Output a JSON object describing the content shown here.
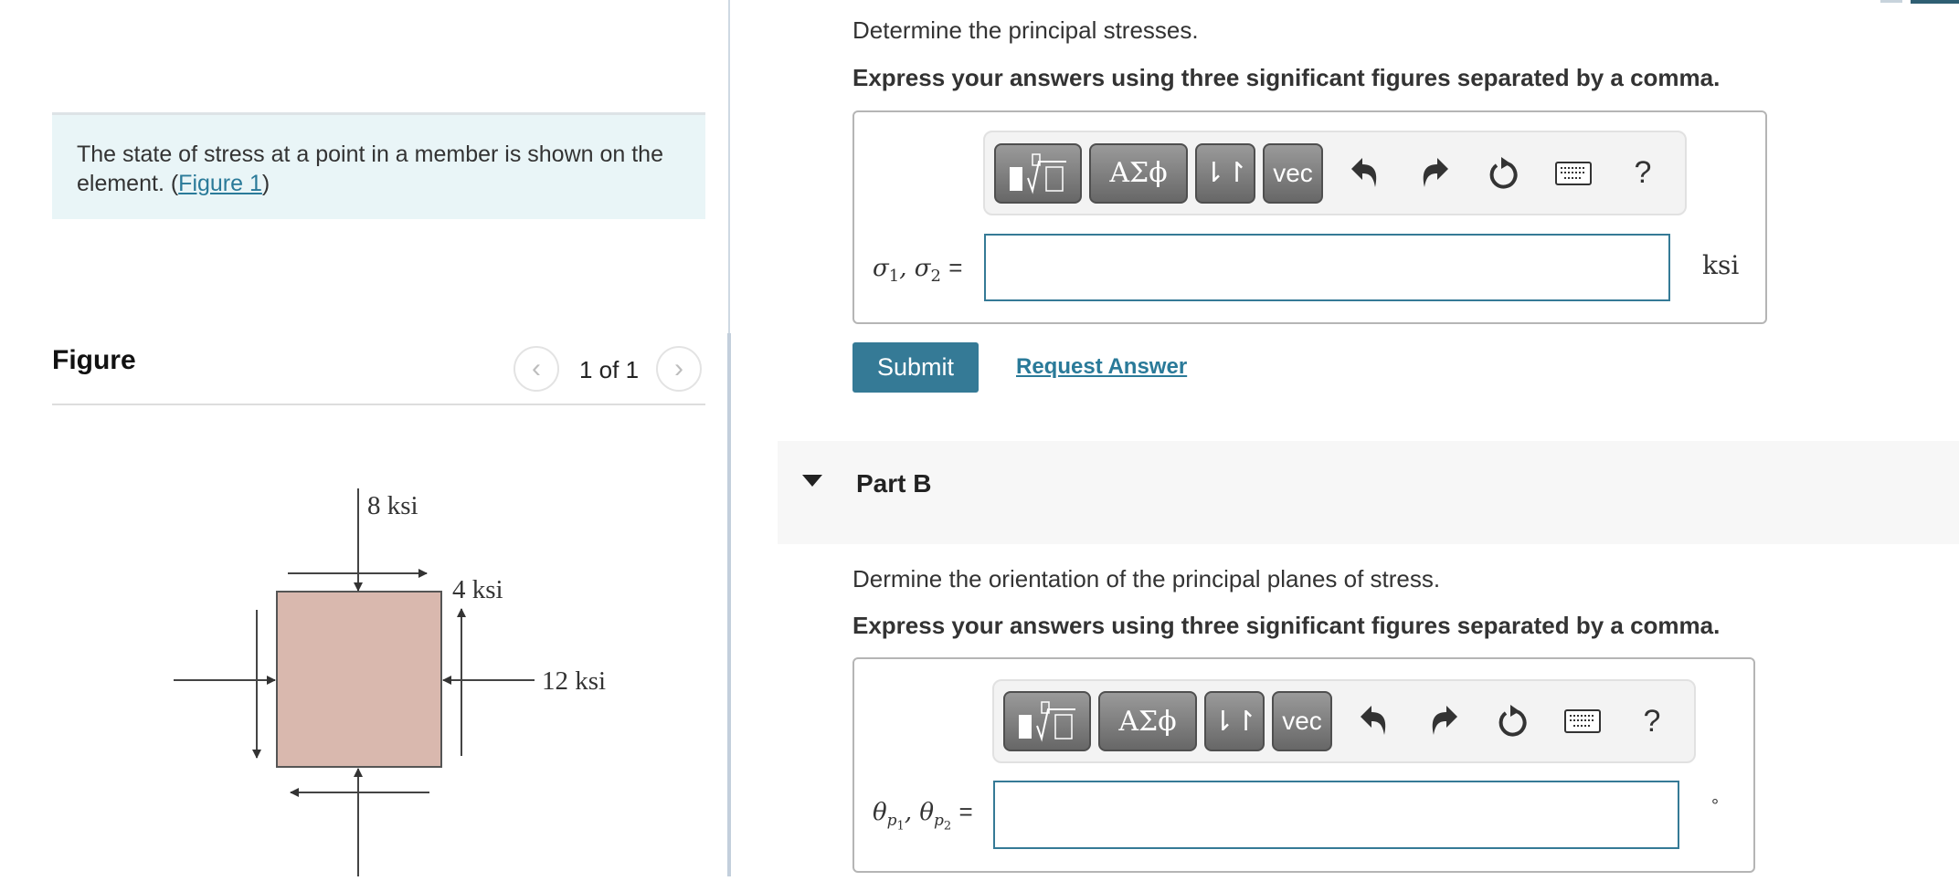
{
  "problem": {
    "intro_text": "The state of stress at a point in a member is shown on the element. (",
    "figure_link": "Figure 1",
    "intro_close": ")"
  },
  "figure_panel": {
    "title": "Figure",
    "page_indicator": "1 of 1",
    "prev_icon": "‹",
    "next_icon": "›",
    "diagram": {
      "label_vertical": "8 ksi",
      "label_shear": "4 ksi",
      "label_horizontal": "12 ksi",
      "element_color": "#d9b8ae"
    }
  },
  "part_a": {
    "prompt": "Determine the principal stresses.",
    "instruction": "Express your answers using three significant figures separated by a comma.",
    "toolbar": {
      "templates_icon": "templates-icon",
      "greek_label": "ΑΣϕ",
      "arrows_label": "⇂↾",
      "vec_label": "vec",
      "help_label": "?"
    },
    "answer_label_html": "σ1, σ2",
    "answer_value": "",
    "unit": "ksi",
    "submit_label": "Submit",
    "request_answer_label": "Request Answer"
  },
  "part_b": {
    "title": "Part B",
    "prompt": "Dermine the orientation of the principal planes of stress.",
    "instruction": "Express your answers using three significant figures separated by a comma.",
    "toolbar": {
      "greek_label": "ΑΣϕ",
      "arrows_label": "⇂↾",
      "vec_label": "vec",
      "help_label": "?"
    },
    "answer_value": "",
    "unit": "°"
  },
  "colors": {
    "accent": "#357a96",
    "link": "#2a7a99",
    "intro_bg": "#e9f5f7"
  }
}
